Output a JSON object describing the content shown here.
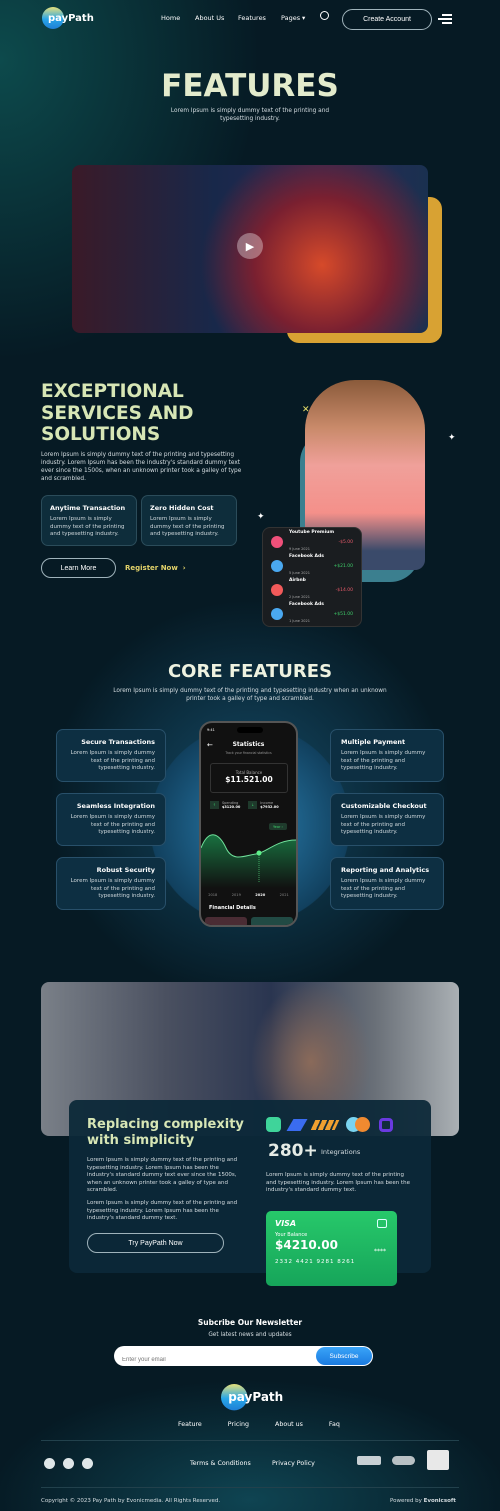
{
  "nav": {
    "logo": "payPath",
    "links": [
      "Home",
      "About Us",
      "Features",
      "Pages"
    ],
    "create_account": "Create Account"
  },
  "hero": {
    "title": "FEATURES",
    "subtitle_1": "Lorem Ipsum is simply dummy text of the printing and",
    "subtitle_2": "typesetting industry."
  },
  "services": {
    "title_1": "EXCEPTIONAL",
    "title_2": "SERVICES AND",
    "title_3": "SOLUTIONS",
    "text": "Lorem Ipsum is simply dummy text of the printing and typesetting industry. Lorem Ipsum has been the industry's standard dummy text ever since the 1500s, when an unknown printer took a galley of type and scrambled.",
    "cards": [
      {
        "title": "Anytime Transaction",
        "text": "Lorem Ipsum is simply dummy text of the printing and typesetting industry."
      },
      {
        "title": "Zero Hidden Cost",
        "text": "Lorem Ipsum is simply dummy text of the printing and typesetting industry."
      }
    ],
    "learn_more": "Learn More",
    "register_now": "Register Now",
    "transactions": [
      {
        "name": "Youtube Premium",
        "date": "9 June 2021",
        "amount": "-$5.00",
        "color": "#f0507a",
        "amount_color": "#e85a6a"
      },
      {
        "name": "Facebook Ads",
        "date": "5 June 2021",
        "amount": "+$21.00",
        "color": "#4aa8f0",
        "amount_color": "#3ecf6a"
      },
      {
        "name": "Airbnb",
        "date": "2 June 2021",
        "amount": "-$14.00",
        "color": "#f25a5a",
        "amount_color": "#e85a6a"
      },
      {
        "name": "Facebook Ads",
        "date": "1 June 2021",
        "amount": "+$51.00",
        "color": "#4aa8f0",
        "amount_color": "#3ecf6a"
      }
    ]
  },
  "core": {
    "title": "CORE FEATURES",
    "subtitle_1": "Lorem Ipsum is simply dummy text of the printing and typesetting industry when an unknown",
    "subtitle_2": "printer took a galley of type and scrambled.",
    "left": [
      {
        "title": "Secure Transactions",
        "text": "Lorem Ipsum is simply dummy text of the printing and typesetting industry."
      },
      {
        "title": "Seamless Integration",
        "text": "Lorem Ipsum is simply dummy text of the printing and typesetting industry."
      },
      {
        "title": "Robust Security",
        "text": "Lorem Ipsum is simply dummy text of the printing and typesetting industry."
      }
    ],
    "right": [
      {
        "title": "Multiple Payment",
        "text": "Lorem Ipsum is simply dummy text of the printing and typesetting industry."
      },
      {
        "title": "Customizable Checkout",
        "text": "Lorem Ipsum is simply dummy text of the printing and typesetting industry."
      },
      {
        "title": "Reporting and Analytics",
        "text": "Lorem Ipsum is simply dummy text of the printing and typesetting industry."
      }
    ],
    "phone": {
      "time": "9:41",
      "title": "Statistics",
      "subtitle": "Track your financial statistics",
      "balance_label": "Total Balance",
      "balance": "$11.521.00",
      "spending_label": "Spending",
      "spending": "$3120.00",
      "income_label": "Income",
      "income": "$7932.00",
      "period": "Year",
      "years": [
        "2018",
        "2019",
        "2020",
        "2021"
      ],
      "details": "Financial Details"
    }
  },
  "simplicity": {
    "title_1": "Replacing complexity",
    "title_2": "with simplicity",
    "text_1": "Lorem Ipsum is simply dummy text of the printing and typesetting industry. Lorem Ipsum has been the industry's standard dummy text ever since the 1500s, when an unknown printer took a galley of type and scrambled.",
    "text_2": "Lorem Ipsum is simply dummy text of the printing and typesetting industry. Lorem Ipsum has been the industry's standard dummy text.",
    "cta": "Try PayPath Now",
    "count": "280+",
    "count_label": "Integrations",
    "text_3": "Lorem Ipsum is simply dummy text of the printing and typesetting industry. Lorem Ipsum has been the industry's standard dummy text.",
    "card": {
      "brand": "VISA",
      "label": "Your Balance",
      "balance": "$4210.00",
      "dots": "****",
      "number": "2332 4421 9281 8261"
    }
  },
  "newsletter": {
    "title": "Subcribe Our Newsletter",
    "subtitle": "Get latest news and updates",
    "placeholder": "Enter your email",
    "button": "Subscribe"
  },
  "footer": {
    "logo": "payPath",
    "links": [
      "Feature",
      "Pricing",
      "About us",
      "Faq"
    ],
    "terms": "Terms & Conditions",
    "privacy": "Privacy Policy",
    "copyright": "Copyright © 2023 Pay Path by Evonicmedia. All Rights Reserved.",
    "powered": "Powered by",
    "powered_by": "Evonicsoft",
    "socials": [
      "twitter-icon",
      "facebook-icon",
      "instagram-icon"
    ]
  },
  "colors": {
    "accent": "#d7e6b5",
    "gold": "#d8a233",
    "green": "#1fbf66",
    "blue": "#2f8cf0"
  }
}
